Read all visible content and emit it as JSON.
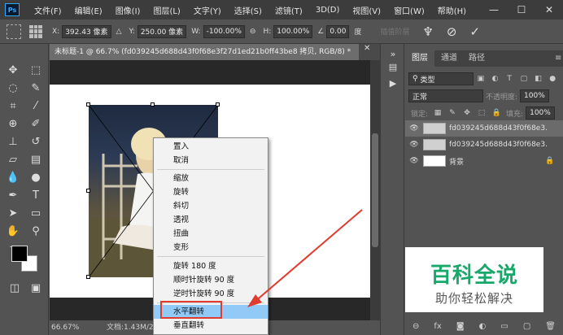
{
  "menubar": {
    "logo": "Ps",
    "items": [
      "文件(F)",
      "编辑(E)",
      "图像(I)",
      "图层(L)",
      "文字(Y)",
      "选择(S)",
      "滤镜(T)",
      "3D(D)",
      "视图(V)",
      "窗口(W)",
      "帮助(H)"
    ],
    "minimize": "—",
    "maximize": "☐",
    "close": "✕"
  },
  "options": {
    "x_label": "X:",
    "x_value": "392.43 像素",
    "y_label": "Y:",
    "y_value": "250.00 像素",
    "w_label": "W:",
    "w_value": "-100.00%",
    "h_label": "H:",
    "h_value": "100.00%",
    "angle_value": "0.00",
    "angle_unit": "度",
    "interp_mode": "插值阶层"
  },
  "document": {
    "tab_title": "未标题-1 @ 66.7% (fd039245d688d43f0f68e3f27d1ed21b0ff43be8 拷贝, RGB/8) *",
    "zoom": "66.67%",
    "doc_info": "文档:1.43M/2.8"
  },
  "context_menu": {
    "items": [
      {
        "label": "置入",
        "highlighted": false
      },
      {
        "label": "取消",
        "highlighted": false
      },
      {
        "label": "缩放",
        "highlighted": false
      },
      {
        "label": "旋转",
        "highlighted": false
      },
      {
        "label": "斜切",
        "highlighted": false
      },
      {
        "label": "透视",
        "highlighted": false
      },
      {
        "label": "扭曲",
        "highlighted": false
      },
      {
        "label": "变形",
        "highlighted": false
      },
      {
        "label": "旋转 180 度",
        "highlighted": false
      },
      {
        "label": "顺时针旋转 90 度",
        "highlighted": false
      },
      {
        "label": "逆时针旋转 90 度",
        "highlighted": false
      },
      {
        "label": "水平翻转",
        "highlighted": true
      },
      {
        "label": "垂直翻转",
        "highlighted": false
      }
    ]
  },
  "layers_panel": {
    "tabs": [
      "图层",
      "通道",
      "路径"
    ],
    "filter_kind": "类型",
    "blend_mode": "正常",
    "opacity_label": "不透明度:",
    "opacity_value": "100%",
    "lock_label": "锁定:",
    "fill_label": "填充:",
    "fill_value": "100%",
    "layers": [
      {
        "name": "fd039245d688d43f0f68e3...",
        "selected": true,
        "type": "smart"
      },
      {
        "name": "fd039245d688d43f0f68e3...",
        "selected": false,
        "type": "smart"
      },
      {
        "name": "背景",
        "selected": false,
        "type": "background"
      }
    ]
  },
  "watermark": {
    "title": "百科全说",
    "subtitle": "助你轻松解决"
  },
  "colors": {
    "menu_highlight": "#91c9f7",
    "annotation_red": "#e03b2f",
    "watermark_green": "#17a86a"
  }
}
